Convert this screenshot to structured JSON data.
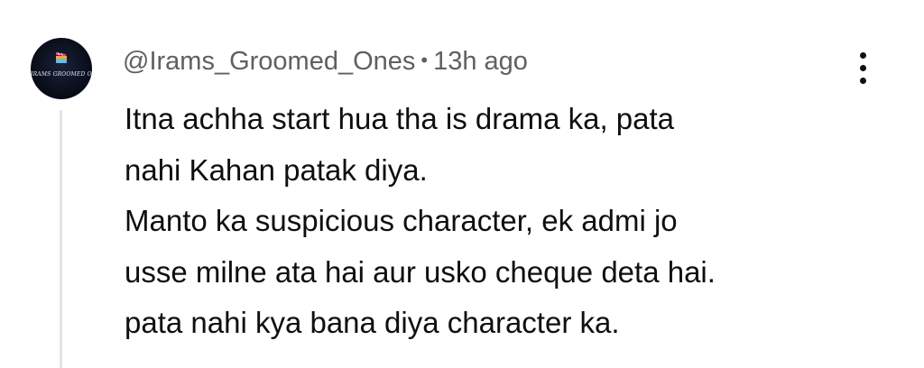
{
  "comment": {
    "avatar": {
      "text": "IRAMS GROOMED ONES",
      "icon": "clapperboard-logo"
    },
    "author": "@Irams_Groomed_Ones",
    "separator": "•",
    "timestamp": "13h ago",
    "lines": [
      "Itna achha start hua tha is drama ka, pata",
      "nahi Kahan patak diya.",
      "Manto ka suspicious character, ek admi jo",
      "usse milne ata hai aur usko cheque deta hai.",
      "pata nahi kya bana diya character ka."
    ],
    "menu_icon": "more-vertical-icon"
  },
  "colors": {
    "text": "#0f0f0f",
    "meta": "#606060",
    "thread_line": "#e4e4e4",
    "avatar_bg": "#070b16"
  }
}
